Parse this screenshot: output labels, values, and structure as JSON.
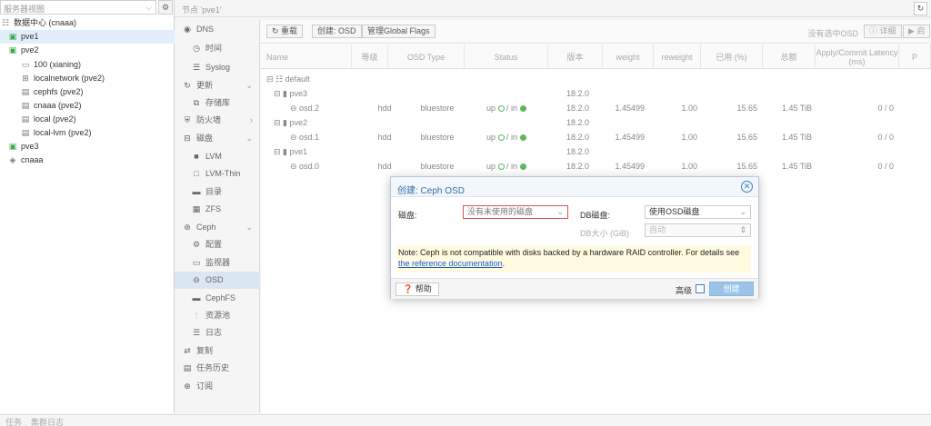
{
  "tree": {
    "view_label": "服务器视图",
    "items": [
      {
        "label": "数据中心 (cnaaa)",
        "icon": "datacenter-icon"
      },
      {
        "label": "pve1",
        "icon": "server-icon"
      },
      {
        "label": "pve2",
        "icon": "server-icon"
      },
      {
        "label": "100 (xianing)",
        "icon": "vm-icon"
      },
      {
        "label": "localnetwork (pve2)",
        "icon": "network-icon"
      },
      {
        "label": "cephfs (pve2)",
        "icon": "storage-icon"
      },
      {
        "label": "cnaaa (pve2)",
        "icon": "storage-icon"
      },
      {
        "label": "local (pve2)",
        "icon": "storage-icon"
      },
      {
        "label": "local-lvm (pve2)",
        "icon": "storage-icon"
      },
      {
        "label": "pve3",
        "icon": "server-icon"
      },
      {
        "label": "cnaaa",
        "icon": "tag-icon"
      }
    ]
  },
  "topbar": {
    "title": "节点 'pve1'"
  },
  "menu": {
    "items": [
      {
        "label": "DNS",
        "icon": "globe-icon"
      },
      {
        "label": "时间",
        "icon": "clock-icon"
      },
      {
        "label": "Syslog",
        "icon": "list-icon"
      },
      {
        "label": "更新",
        "icon": "refresh-icon"
      },
      {
        "label": "存储库",
        "icon": "repo-icon"
      },
      {
        "label": "防火墙",
        "icon": "shield-icon"
      },
      {
        "label": "磁盘",
        "icon": "disk-icon"
      },
      {
        "label": "LVM",
        "icon": "square-icon"
      },
      {
        "label": "LVM-Thin",
        "icon": "square-outline-icon"
      },
      {
        "label": "目录",
        "icon": "folder-icon"
      },
      {
        "label": "ZFS",
        "icon": "grid-icon"
      },
      {
        "label": "Ceph",
        "icon": "ceph-icon"
      },
      {
        "label": "配置",
        "icon": "gear-icon"
      },
      {
        "label": "监视器",
        "icon": "desktop-icon"
      },
      {
        "label": "OSD",
        "icon": "hdd-icon"
      },
      {
        "label": "CephFS",
        "icon": "folder-icon"
      },
      {
        "label": "资源池",
        "icon": "sitemap-icon"
      },
      {
        "label": "日志",
        "icon": "list-icon"
      },
      {
        "label": "复制",
        "icon": "retweet-icon"
      },
      {
        "label": "任务历史",
        "icon": "list-alt-icon"
      },
      {
        "label": "订阅",
        "icon": "support-icon"
      }
    ]
  },
  "toolbar": {
    "reload": "重载",
    "create_osd": "创建: OSD",
    "manage_flags": "管理Global Flags",
    "no_selection": "没有选中OSD",
    "details": "详细",
    "start": "启"
  },
  "columns": [
    "Name",
    "等级",
    "OSD Type",
    "Status",
    "版本",
    "weight",
    "reweight",
    "已用 (%)",
    "总额",
    "Apply/Commit Latency (ms)",
    "P"
  ],
  "rows": [
    {
      "name": "default",
      "level": 0,
      "type": "root"
    },
    {
      "name": "pve3",
      "level": 1,
      "type": "host",
      "version": "18.2.0"
    },
    {
      "name": "osd.2",
      "level": 2,
      "type": "osd",
      "class": "hdd",
      "osd_type": "bluestore",
      "status": "up",
      "in": "in",
      "version": "18.2.0",
      "weight": "1.45499",
      "reweight": "1.00",
      "used": "15.65",
      "total": "1.45 TiB",
      "latency": "0 / 0"
    },
    {
      "name": "pve2",
      "level": 1,
      "type": "host",
      "version": "18.2.0"
    },
    {
      "name": "osd.1",
      "level": 2,
      "type": "osd",
      "class": "hdd",
      "osd_type": "bluestore",
      "status": "up",
      "in": "in",
      "version": "18.2.0",
      "weight": "1.45499",
      "reweight": "1.00",
      "used": "15.65",
      "total": "1.45 TiB",
      "latency": "0 / 0"
    },
    {
      "name": "pve1",
      "level": 1,
      "type": "host",
      "version": "18.2.0"
    },
    {
      "name": "osd.0",
      "level": 2,
      "type": "osd",
      "class": "hdd",
      "osd_type": "bluestore",
      "status": "up",
      "in": "in",
      "version": "18.2.0",
      "weight": "1.45499",
      "reweight": "1.00",
      "used": "15.65",
      "total": "1.45 TiB",
      "latency": "0 / 0"
    }
  ],
  "modal": {
    "title": "创建: Ceph OSD",
    "disk_label": "磁盘:",
    "disk_value": "没有未使用的磁盘",
    "db_disk_label": "DB磁盘:",
    "db_disk_value": "使用OSD磁盘",
    "db_size_label": "DB大小 (GiB)",
    "db_size_value": "自动",
    "note_text": "Note: Ceph is not compatible with disks backed by a hardware RAID controller. For details see ",
    "note_link": "the reference documentation",
    "note_end": ".",
    "help": "帮助",
    "advanced": "高级",
    "create": "创建"
  },
  "bottom": {
    "tab1": "任务",
    "tab2": "集群日志"
  }
}
